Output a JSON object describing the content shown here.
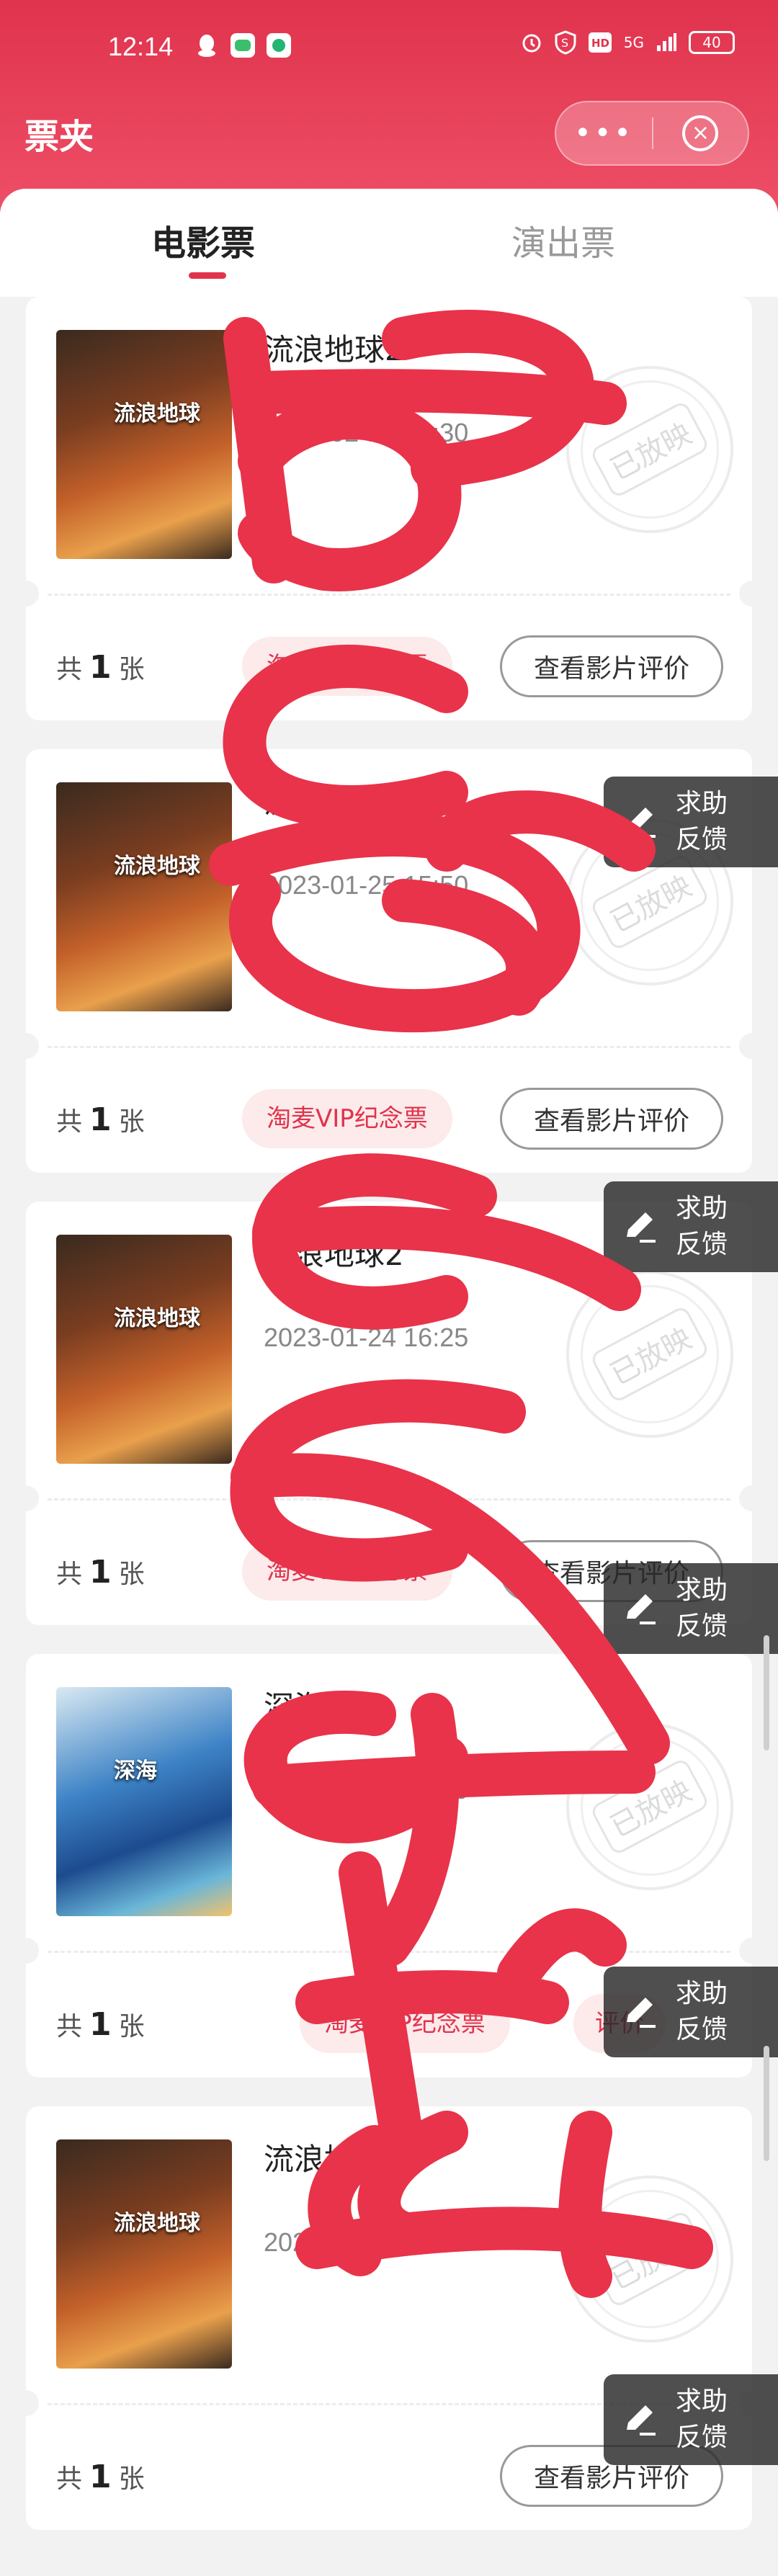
{
  "status_bar": {
    "time": "12:14",
    "icons": [
      "qq-icon",
      "wechat-icon",
      "message-icon"
    ],
    "right_icons": [
      "alarm-icon",
      "s-icon",
      "hd-icon",
      "5g-signal-icon"
    ],
    "network": "5G",
    "battery": "40"
  },
  "header": {
    "title": "票夹",
    "more_glyph": "•••",
    "close_glyph": "×"
  },
  "tabs": [
    {
      "label": "电影票",
      "active": true
    },
    {
      "label": "演出票",
      "active": false
    }
  ],
  "tickets": [
    {
      "title": "流浪地球2",
      "datetime": "2023-02-10 19:30",
      "count_prefix": "共",
      "count": "1",
      "count_suffix": "张",
      "tag": "淘麦VIP纪念票",
      "review_btn": "查看影片评价",
      "stamp": "已放映",
      "poster": "wandering",
      "poster_title": "流浪地球"
    },
    {
      "title": "流浪地球2",
      "datetime": "2023-01-25 15:50",
      "count_prefix": "共",
      "count": "1",
      "count_suffix": "张",
      "tag": "淘麦VIP纪念票",
      "review_btn": "查看影片评价",
      "stamp": "已放映",
      "poster": "wandering",
      "poster_title": "流浪地球"
    },
    {
      "title": "流浪地球2",
      "datetime": "2023-01-24 16:25",
      "count_prefix": "共",
      "count": "1",
      "count_suffix": "张",
      "tag": "淘麦VIP纪念票",
      "review_btn": "查看影片评价",
      "stamp": "已放映",
      "poster": "wandering",
      "poster_title": "流浪地球"
    },
    {
      "title": "深海",
      "datetime": "2023-01-23 15:50",
      "count_prefix": "共",
      "count": "1",
      "count_suffix": "张",
      "tag": "淘麦VIP纪念票",
      "review_btn": "评价",
      "stamp": "已放映",
      "poster": "sea",
      "poster_title": "深海"
    },
    {
      "title": "流浪地球2",
      "datetime": "2023-01-23 12:40",
      "count_prefix": "共",
      "count": "1",
      "count_suffix": "张",
      "tag": "",
      "review_btn": "查看影片评价",
      "stamp": "已放映",
      "poster": "wandering",
      "poster_title": "流浪地球"
    }
  ],
  "feedback": {
    "line1": "求助",
    "line2": "反馈"
  },
  "colors": {
    "accent": "#e0334d",
    "header_gradient_top": "#e0334d",
    "header_gradient_bottom": "#f0526a",
    "scribble": "#e8334a"
  }
}
